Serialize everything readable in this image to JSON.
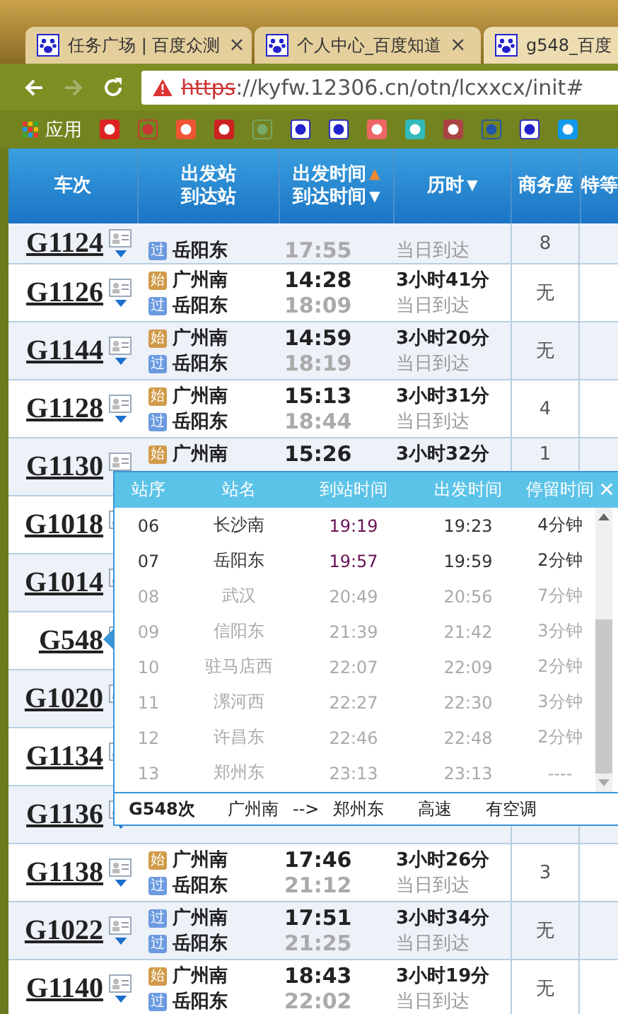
{
  "browser": {
    "tabs": [
      {
        "title": "任务广场 | 百度众测",
        "selected": false
      },
      {
        "title": "个人中心_百度知道",
        "selected": false
      },
      {
        "title": "g548_百度",
        "selected": true
      }
    ],
    "tab_close": "×",
    "address": {
      "scheme": "https",
      "rest": "://kyfw.12306.cn/otn/lcxxcx/init#",
      "insecure": true
    },
    "bookmarks": [
      {
        "label": "应用"
      }
    ]
  },
  "table": {
    "columns": [
      {
        "lines": [
          {
            "text": "车次"
          }
        ]
      },
      {
        "lines": [
          {
            "text": "出发站"
          },
          {
            "text": "到达站"
          }
        ]
      },
      {
        "lines": [
          {
            "text": "出发时间",
            "arrow": "▲",
            "active": true
          },
          {
            "text": "到达时间",
            "arrow": "▼",
            "active": false
          }
        ]
      },
      {
        "lines": [
          {
            "text": "历时",
            "arrow": "▼",
            "active": false
          }
        ]
      },
      {
        "lines": [
          {
            "text": "商务座"
          }
        ]
      },
      {
        "lines": [
          {
            "text": "特等"
          }
        ]
      }
    ],
    "rows": [
      {
        "train": "G1124",
        "arrive_station": {
          "badge": "过",
          "kind": "pass",
          "name": "岳阳东"
        },
        "arrive_time": "17:55",
        "arrival_note": "当日到达",
        "business": "8"
      },
      {
        "train": "G1126",
        "depart_station": {
          "badge": "始",
          "kind": "start",
          "name": "广州南"
        },
        "arrive_station": {
          "badge": "过",
          "kind": "pass",
          "name": "岳阳东"
        },
        "depart_time": "14:28",
        "arrive_time": "18:09",
        "duration": "3小时41分",
        "arrival_note": "当日到达",
        "business": "无"
      },
      {
        "train": "G1144",
        "depart_station": {
          "badge": "始",
          "kind": "start",
          "name": "广州南"
        },
        "arrive_station": {
          "badge": "过",
          "kind": "pass",
          "name": "岳阳东"
        },
        "depart_time": "14:59",
        "arrive_time": "18:19",
        "duration": "3小时20分",
        "arrival_note": "当日到达",
        "business": "无"
      },
      {
        "train": "G1128",
        "depart_station": {
          "badge": "始",
          "kind": "start",
          "name": "广州南"
        },
        "arrive_station": {
          "badge": "过",
          "kind": "pass",
          "name": "岳阳东"
        },
        "depart_time": "15:13",
        "arrive_time": "18:44",
        "duration": "3小时31分",
        "arrival_note": "当日到达",
        "business": "4"
      },
      {
        "train": "G1130",
        "depart_station": {
          "badge": "始",
          "kind": "start",
          "name": "广州南"
        },
        "depart_time": "15:26",
        "duration": "3小时32分",
        "business": "1"
      },
      {
        "train": "G1018"
      },
      {
        "train": "G1014"
      },
      {
        "train": "G548"
      },
      {
        "train": "G1020"
      },
      {
        "train": "G1134"
      },
      {
        "train": "G1136"
      },
      {
        "train": "G1138",
        "depart_station": {
          "badge": "始",
          "kind": "start",
          "name": "广州南"
        },
        "arrive_station": {
          "badge": "过",
          "kind": "pass",
          "name": "岳阳东"
        },
        "depart_time": "17:46",
        "arrive_time": "21:12",
        "duration": "3小时26分",
        "arrival_note": "当日到达",
        "business": "3"
      },
      {
        "train": "G1022",
        "depart_station": {
          "badge": "过",
          "kind": "pass",
          "name": "广州南"
        },
        "arrive_station": {
          "badge": "过",
          "kind": "pass",
          "name": "岳阳东"
        },
        "depart_time": "17:51",
        "arrive_time": "21:25",
        "duration": "3小时34分",
        "arrival_note": "当日到达",
        "business": "无"
      },
      {
        "train": "G1140",
        "depart_station": {
          "badge": "始",
          "kind": "start",
          "name": "广州南"
        },
        "arrive_station": {
          "badge": "过",
          "kind": "pass",
          "name": "岳阳东"
        },
        "depart_time": "18:43",
        "arrive_time": "22:02",
        "duration": "3小时19分",
        "arrival_note": "当日到达",
        "business": "无"
      }
    ]
  },
  "stops_popup": {
    "columns": [
      "站序",
      "站名",
      "到站时间",
      "出发时间",
      "停留时间"
    ],
    "close": "✕",
    "stops": [
      {
        "no": "06",
        "station": "长沙南",
        "arrive": "19:19",
        "depart": "19:23",
        "stay": "4分钟",
        "highlighted": true
      },
      {
        "no": "07",
        "station": "岳阳东",
        "arrive": "19:57",
        "depart": "19:59",
        "stay": "2分钟",
        "highlighted": true
      },
      {
        "no": "08",
        "station": "武汉",
        "arrive": "20:49",
        "depart": "20:56",
        "stay": "7分钟",
        "highlighted": false
      },
      {
        "no": "09",
        "station": "信阳东",
        "arrive": "21:39",
        "depart": "21:42",
        "stay": "3分钟",
        "highlighted": false
      },
      {
        "no": "10",
        "station": "驻马店西",
        "arrive": "22:07",
        "depart": "22:09",
        "stay": "2分钟",
        "highlighted": false
      },
      {
        "no": "11",
        "station": "漯河西",
        "arrive": "22:27",
        "depart": "22:30",
        "stay": "3分钟",
        "highlighted": false
      },
      {
        "no": "12",
        "station": "许昌东",
        "arrive": "22:46",
        "depart": "22:48",
        "stay": "2分钟",
        "highlighted": false
      },
      {
        "no": "13",
        "station": "郑州东",
        "arrive": "23:13",
        "depart": "23:13",
        "stay": "----",
        "highlighted": false
      }
    ],
    "footer": {
      "train": "G548次",
      "from": "广州南",
      "arrow": "-->",
      "to": "郑州东",
      "type": "高速",
      "aircon": "有空调"
    }
  }
}
